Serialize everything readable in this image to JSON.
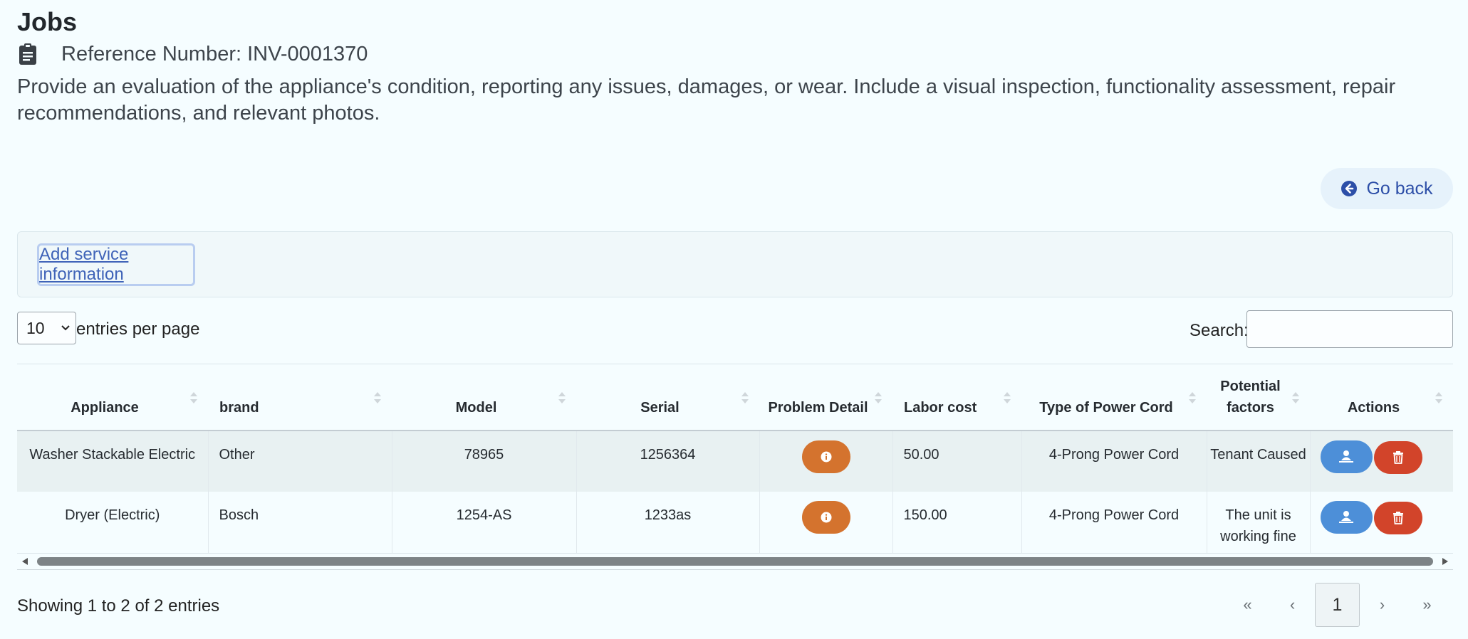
{
  "header": {
    "title": "Jobs",
    "reference": "Reference Number: INV-0001370",
    "description": "Provide an evaluation of the appliance's condition, reporting any issues, damages, or wear. Include a visual inspection, functionality assessment, repair recommendations, and relevant photos."
  },
  "go_back": {
    "label": "Go back",
    "icon": "arrow-circle-left-icon"
  },
  "service": {
    "link_label": "Add service information"
  },
  "table_controls": {
    "page_size": "10",
    "page_size_label": "entries per page",
    "search_label": "Search:",
    "search_value": ""
  },
  "table": {
    "columns": [
      "Appliance",
      "brand",
      "Model",
      "Serial",
      "Problem Detail",
      "Labor cost",
      "Type of Power Cord",
      "Potential factors",
      "Actions"
    ],
    "rows": [
      {
        "appliance": "Washer Stackable Electric",
        "brand": "Other",
        "model": "78965",
        "serial": "1256364",
        "labor_cost": "50.00",
        "power_cord": "4-Prong Power Cord",
        "factors": "Tenant Caused"
      },
      {
        "appliance": "Dryer (Electric)",
        "brand": "Bosch",
        "model": "1254-AS",
        "serial": "1233as",
        "labor_cost": "150.00",
        "power_cord": "4-Prong Power Cord",
        "factors": "The unit is working fine"
      }
    ]
  },
  "footer": {
    "info": "Showing 1 to 2 of 2 entries",
    "pagination": {
      "first": "«",
      "prev": "‹",
      "current": "1",
      "next": "›",
      "last": "»"
    }
  },
  "colors": {
    "background": "#f5fdff",
    "info_button": "#d4732e",
    "assign_button": "#4d8fd8",
    "delete_button": "#d2442a",
    "link": "#3f63b8"
  }
}
